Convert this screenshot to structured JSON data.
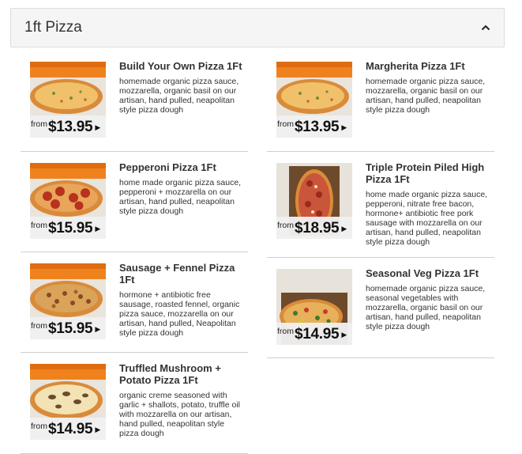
{
  "section": {
    "title": "1ft Pizza",
    "toggle_icon": "chevron-up-icon"
  },
  "items_left": [
    {
      "name": "Build Your Own Pizza 1Ft",
      "desc": "homemade organic pizza sauce, mozzarella, organic basil on our artisan, hand pulled, neapolitan style pizza dough",
      "from": "from",
      "price": "$13.95",
      "image": "cheese-flatbread"
    },
    {
      "name": "Pepperoni Pizza 1Ft",
      "desc": "home made organic pizza sauce, pepperoni + mozzarella on our artisan, hand pulled, neapolitan style pizza dough",
      "from": "from",
      "price": "$15.95",
      "image": "pepperoni-flatbread"
    },
    {
      "name": "Sausage + Fennel Pizza 1Ft",
      "desc": "hormone + antibiotic free sausage, roasted fennel, organic pizza sauce, mozzarella on our artisan, hand pulled, Neapolitan style pizza dough",
      "from": "from",
      "price": "$15.95",
      "image": "sausage-flatbread"
    },
    {
      "name": "Truffled Mushroom + Potato Pizza 1Ft",
      "desc": "organic creme seasoned with garlic + shallots, potato, truffle oil with mozzarella on our artisan, hand pulled, neapolitan style pizza dough",
      "from": "from",
      "price": "$14.95",
      "image": "mushroom-flatbread"
    }
  ],
  "items_right": [
    {
      "name": "Margherita Pizza 1Ft",
      "desc": "homemade organic pizza sauce, mozzarella, organic basil on our artisan, hand pulled, neapolitan style pizza dough",
      "from": "from",
      "price": "$13.95",
      "image": "cheese-flatbread"
    },
    {
      "name": "Triple Protein Piled High Pizza 1Ft",
      "desc": "home made organic pizza sauce, pepperoni, nitrate free bacon, hormone+ antibiotic free pork sausage with mozzarella on our artisan, hand pulled, neapolitan style pizza dough",
      "from": "from",
      "price": "$18.95",
      "image": "meat-flatbread-board"
    },
    {
      "name": "Seasonal Veg Pizza 1Ft",
      "desc": "homemade organic pizza sauce, seasonal vegetables with mozzarella, organic basil on our artisan, hand pulled, neapolitan style pizza dough",
      "from": "from",
      "price": "$14.95",
      "image": "veg-flatbread-board"
    }
  ],
  "colors": {
    "header_bg": "#f5f5f5",
    "divider": "#cfcfcf",
    "text": "#333333",
    "price": "#111111",
    "wall_orange": "#f0821e"
  }
}
